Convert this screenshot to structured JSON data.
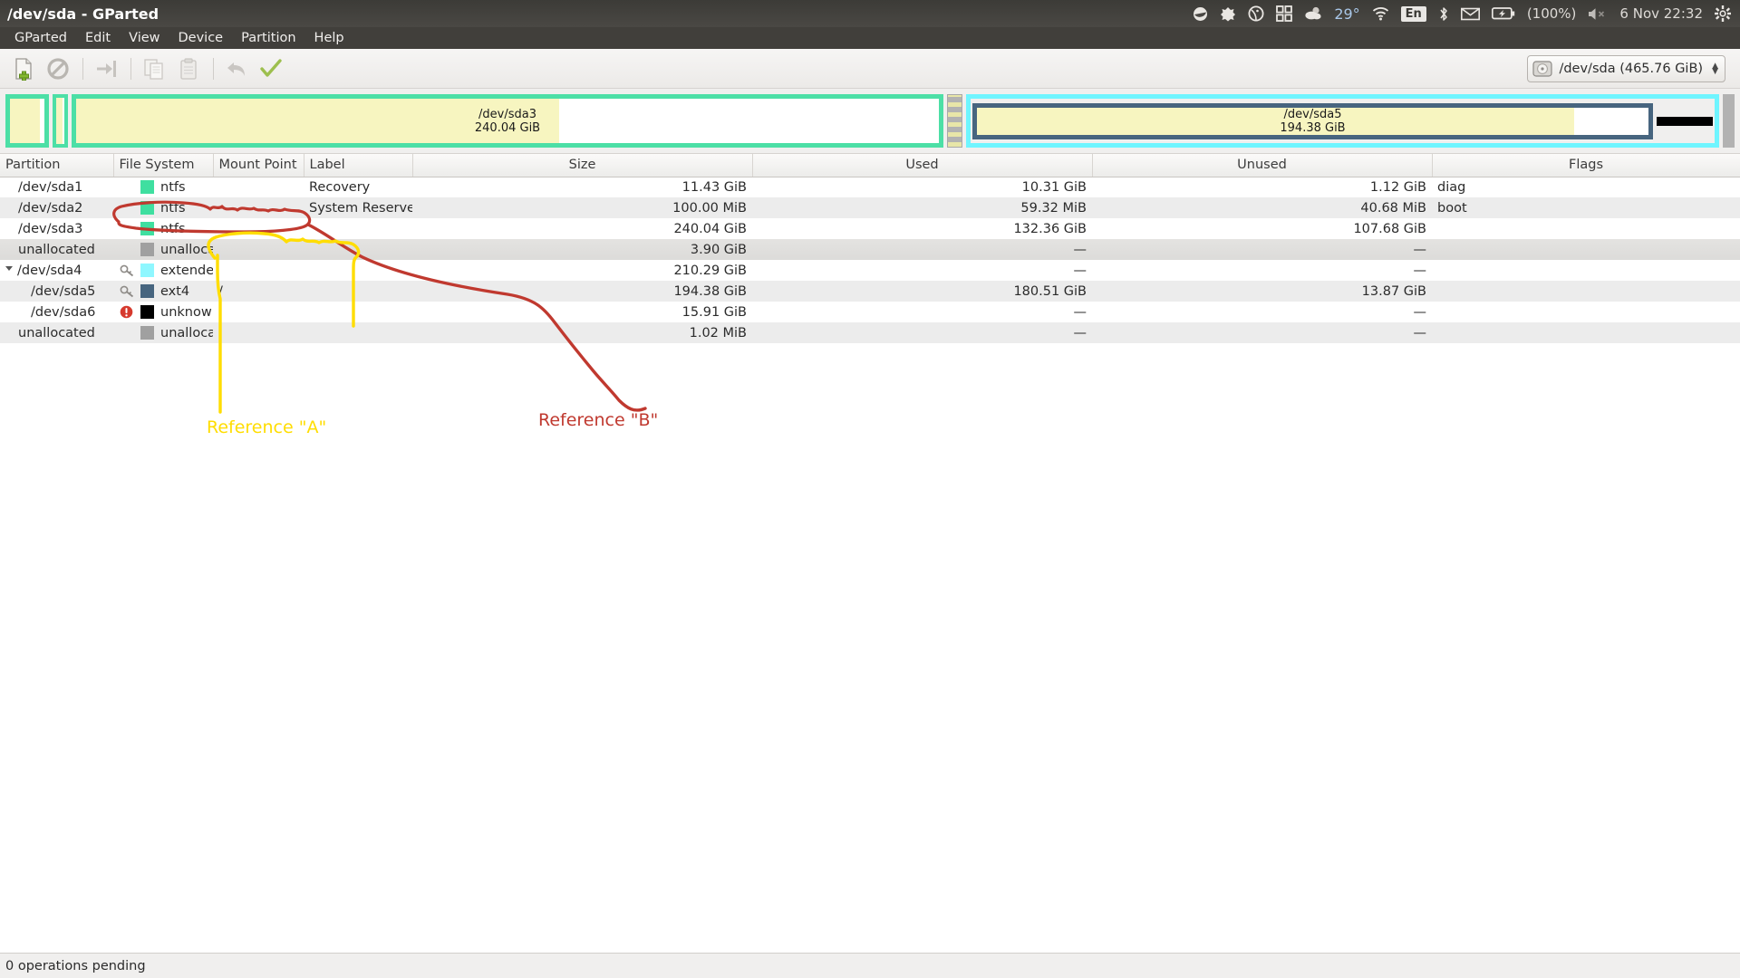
{
  "window": {
    "title": "/dev/sda - GParted"
  },
  "tray": {
    "items": [
      {
        "name": "dropbox-icon",
        "glyph": "◓"
      },
      {
        "name": "sync-icon",
        "glyph": "✣"
      },
      {
        "name": "info-icon",
        "glyph": "ⓘ"
      },
      {
        "name": "workspace-switcher-icon",
        "glyph": "▦"
      },
      {
        "name": "weather-icon",
        "glyph": "☁"
      }
    ],
    "temperature": "29°",
    "network_icon": "wifi-icon",
    "keyboard_layout": "En",
    "bluetooth_icon": "bluetooth-icon",
    "mail_icon": "mail-icon",
    "battery_label": "(100%)",
    "volume_icon": "volume-muted-icon",
    "clock": "6 Nov 22:32",
    "session_icon": "gear-icon"
  },
  "menubar": {
    "items": [
      "GParted",
      "Edit",
      "View",
      "Device",
      "Partition",
      "Help"
    ]
  },
  "toolbar": {
    "buttons": [
      {
        "name": "new-partition-button",
        "label": "New",
        "enabled": true
      },
      {
        "name": "delete-partition-button",
        "label": "Delete",
        "enabled": true
      },
      {
        "name": "resize-move-button",
        "label": "Resize/Move",
        "enabled": false
      },
      {
        "name": "copy-button",
        "label": "Copy",
        "enabled": false
      },
      {
        "name": "paste-button",
        "label": "Paste",
        "enabled": false
      },
      {
        "name": "undo-button",
        "label": "Undo",
        "enabled": false
      },
      {
        "name": "apply-button",
        "label": "Apply",
        "enabled": true
      }
    ],
    "device_selector": {
      "label": "/dev/sda  (465.76 GiB)"
    }
  },
  "graphic": {
    "blocks": [
      {
        "name": "sda1",
        "border": "#4cdfa6",
        "fill_pct": 90,
        "label1": "",
        "label2": "",
        "width_pct": 2.45,
        "kind": "ntfs"
      },
      {
        "name": "sda2",
        "border": "#4cdfa6",
        "fill_pct": 60,
        "label1": "",
        "label2": "",
        "width_pct": 0.9,
        "kind": "ntfs"
      },
      {
        "name": "sda3",
        "border": "#4cdfa6",
        "fill_pct": 55,
        "label1": "/dev/sda3",
        "label2": "240.04 GiB",
        "width_pct": 51.5,
        "kind": "ntfs"
      },
      {
        "name": "unallocated-a",
        "border": "",
        "fill_pct": 0,
        "label1": "",
        "label2": "",
        "width_pct": 1.0,
        "kind": "unallocated"
      },
      {
        "name": "sda4-extended",
        "border": "#6ff5ff",
        "fill_pct": 0,
        "label1": "",
        "label2": "",
        "width_pct": 43.0,
        "kind": "extended"
      }
    ],
    "extended_children": [
      {
        "name": "sda5",
        "border": "#47657f",
        "fill_pct": 93,
        "label1": "/dev/sda5",
        "label2": "194.38 GiB",
        "width_pct": 89.5,
        "kind": "ext4"
      },
      {
        "name": "sda6",
        "border": "#000000",
        "fill_pct": 0,
        "label1": "",
        "label2": "",
        "width_pct": 8.5,
        "kind": "unknown"
      }
    ],
    "trailing_unallocated": {
      "name": "unallocated-b",
      "width_pct": 0.9
    }
  },
  "table": {
    "headers": [
      {
        "key": "partition",
        "label": "Partition",
        "align": "left"
      },
      {
        "key": "filesystem",
        "label": "File System",
        "align": "left"
      },
      {
        "key": "mountpoint",
        "label": "Mount Point",
        "align": "left"
      },
      {
        "key": "label",
        "label": "Label",
        "align": "left"
      },
      {
        "key": "size",
        "label": "Size",
        "align": "center"
      },
      {
        "key": "used",
        "label": "Used",
        "align": "center"
      },
      {
        "key": "unused",
        "label": "Unused",
        "align": "center"
      },
      {
        "key": "flags",
        "label": "Flags",
        "align": "center"
      }
    ],
    "rows": [
      {
        "partition": "/dev/sda1",
        "filesystem": "ntfs",
        "color": "#3fdfa0",
        "mountpoint": "",
        "label": "Recovery",
        "size": "11.43 GiB",
        "used": "10.31 GiB",
        "unused": "1.12 GiB",
        "flags": "diag",
        "indent": 0,
        "icon": "",
        "expander": ""
      },
      {
        "partition": "/dev/sda2",
        "filesystem": "ntfs",
        "color": "#3fdfa0",
        "mountpoint": "",
        "label": "System Reserved",
        "size": "100.00 MiB",
        "used": "59.32 MiB",
        "unused": "40.68 MiB",
        "flags": "boot",
        "indent": 0,
        "icon": "",
        "expander": ""
      },
      {
        "partition": "/dev/sda3",
        "filesystem": "ntfs",
        "color": "#3fdfa0",
        "mountpoint": "",
        "label": "",
        "size": "240.04 GiB",
        "used": "132.36 GiB",
        "unused": "107.68 GiB",
        "flags": "",
        "indent": 0,
        "icon": "",
        "expander": ""
      },
      {
        "partition": "unallocated",
        "filesystem": "unallocated",
        "color": "#a0a0a0",
        "mountpoint": "",
        "label": "",
        "size": "3.90 GiB",
        "used": "—",
        "unused": "—",
        "flags": "",
        "indent": 0,
        "icon": "",
        "expander": "",
        "selected": true
      },
      {
        "partition": "/dev/sda4",
        "filesystem": "extended",
        "color": "#8ff7ff",
        "mountpoint": "",
        "label": "",
        "size": "210.29 GiB",
        "used": "—",
        "unused": "—",
        "flags": "",
        "indent": 0,
        "icon": "key-icon",
        "expander": "open"
      },
      {
        "partition": "/dev/sda5",
        "filesystem": "ext4",
        "color": "#47657f",
        "mountpoint": "/",
        "label": "",
        "size": "194.38 GiB",
        "used": "180.51 GiB",
        "unused": "13.87 GiB",
        "flags": "",
        "indent": 1,
        "icon": "key-icon",
        "expander": ""
      },
      {
        "partition": "/dev/sda6",
        "filesystem": "unknown",
        "color": "#000000",
        "mountpoint": "",
        "label": "",
        "size": "15.91 GiB",
        "used": "—",
        "unused": "—",
        "flags": "",
        "indent": 1,
        "icon": "warning-icon",
        "expander": ""
      },
      {
        "partition": "unallocated",
        "filesystem": "unallocated",
        "color": "#a0a0a0",
        "mountpoint": "",
        "label": "",
        "size": "1.02 MiB",
        "used": "—",
        "unused": "—",
        "flags": "",
        "indent": 0,
        "icon": "",
        "expander": ""
      }
    ]
  },
  "statusbar": {
    "text": "0 operations pending"
  },
  "annotations": {
    "reference_a": {
      "text": "Reference \"A\"",
      "color": "#ffdd00"
    },
    "reference_b": {
      "text": "Reference \"B\"",
      "color": "#c0392f"
    }
  }
}
